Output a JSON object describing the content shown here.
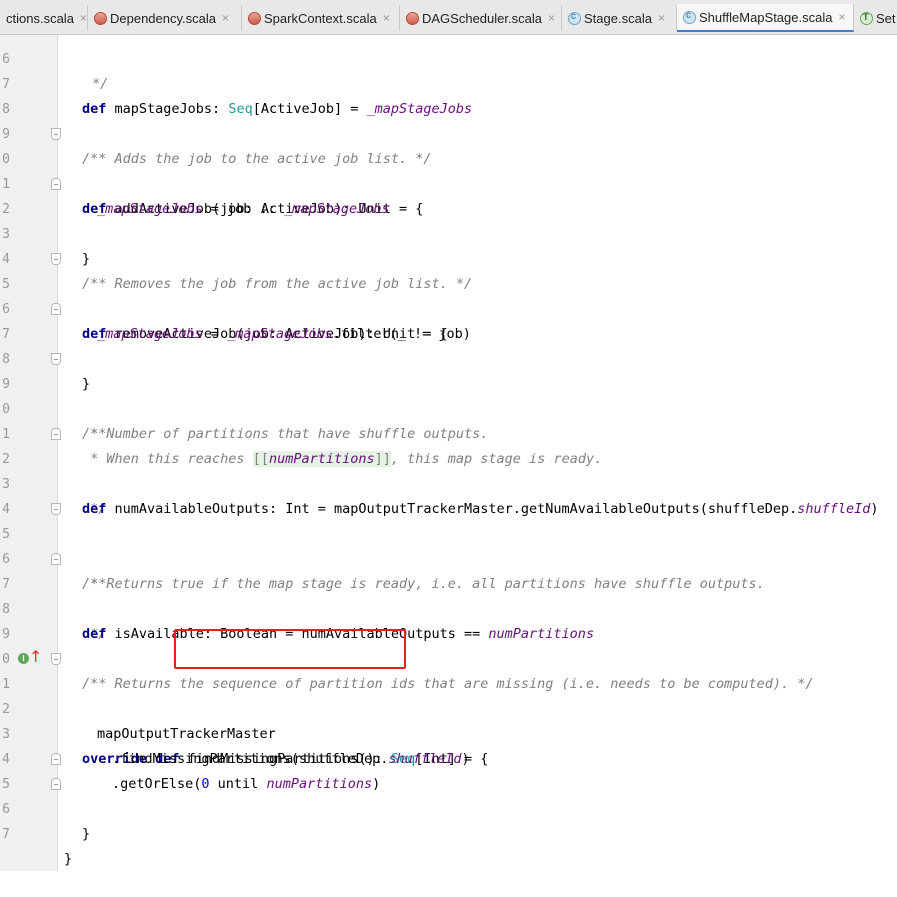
{
  "tabs": [
    {
      "label": "ctions.scala",
      "icon": "scala-file-icon",
      "active": false
    },
    {
      "label": "Dependency.scala",
      "icon": "scala-file-icon",
      "active": false
    },
    {
      "label": "SparkContext.scala",
      "icon": "scala-file-icon",
      "active": false
    },
    {
      "label": "DAGScheduler.scala",
      "icon": "scala-file-icon",
      "active": false
    },
    {
      "label": "Stage.scala",
      "icon": "scala-class-icon",
      "active": false
    },
    {
      "label": "ShuffleMapStage.scala",
      "icon": "scala-class-icon",
      "active": true
    },
    {
      "label": "Set",
      "icon": "scala-trait-icon",
      "active": false
    }
  ],
  "tab_close_glyph": "×",
  "line_numbers": [
    "6",
    "7",
    "8",
    "9",
    "0",
    "1",
    "2",
    "3",
    "4",
    "5",
    "6",
    "7",
    "8",
    "9",
    "0",
    "1",
    "2",
    "3",
    "4",
    "5",
    "6",
    "7",
    "8",
    "9",
    "0",
    "1",
    "2",
    "3",
    "4",
    "5",
    "6",
    "7"
  ],
  "code": {
    "l6": "*/",
    "l7": {
      "kw": "def",
      "a": " mapStageJobs: ",
      "ty": "Seq",
      "b": "[ActiveJob] = ",
      "fld": "_mapStageJobs"
    },
    "l9": "/** Adds the job to the active job list. */",
    "l10": {
      "kw": "def",
      "a": " addActiveJob(job: ActiveJob): Unit = {"
    },
    "l11": {
      "fld": "_mapStageJobs",
      "a": " = job :: ",
      "fld2": "_mapStageJobs"
    },
    "l12": "}",
    "l14": "/** Removes the job from the active job list. */",
    "l15": {
      "kw": "def",
      "a": " removeActiveJob(job: ActiveJob): Unit = {"
    },
    "l16": {
      "fld": "_mapStageJobs",
      "a": " = ",
      "fld2": "_mapStageJobs",
      "b": ".filter(_ != job)"
    },
    "l17": "}",
    "l19": "/**",
    "l20": " * Number of partitions that have shuffle outputs.",
    "l21": {
      "a": " * When this reaches ",
      "hl_open": "[[",
      "hl": "numPartitions",
      "hl_close": "]]",
      "b": ", this map stage is ready."
    },
    "l22": " */",
    "l23": {
      "kw": "def",
      "a": " numAvailableOutputs: Int = mapOutputTrackerMaster.getNumAvailableOutputs(shuffleDep.",
      "fld": "shuffleId",
      "b": ")"
    },
    "l25": "/**",
    "l26": " * Returns true if the map stage is ready, i.e. all partitions have shuffle outputs.",
    "l27": " */",
    "l28": {
      "kw": "def",
      "a": " isAvailable: Boolean = numAvailableOutputs == ",
      "fld": "numPartitions"
    },
    "l30": "/** Returns the sequence of partition ids that are missing (i.e. needs to be computed). */",
    "l31": {
      "kw": "override def",
      "a": " findMissingPartitions(): ",
      "ty": "Seq",
      "b": "[Int] = {"
    },
    "l32": "mapOutputTrackerMaster",
    "l33": {
      "a": ".findMissingPartitions(shuffleDep.",
      "fld": "shuffleId",
      "b": ")"
    },
    "l34": {
      "a": ".getOrElse(",
      "num": "0",
      "b": " until ",
      "fld": "numPartitions",
      "c": ")"
    },
    "l35": "}",
    "l36": "}"
  },
  "override_marker": {
    "badge": "I",
    "arrow": "↑"
  },
  "colors": {
    "keyword": "#000080",
    "comment": "#808080",
    "type": "#20999d",
    "field": "#660e7a",
    "number": "#0000ff",
    "annotation_box": "#e0241b",
    "active_tab_underline": "#3d7fd8"
  }
}
